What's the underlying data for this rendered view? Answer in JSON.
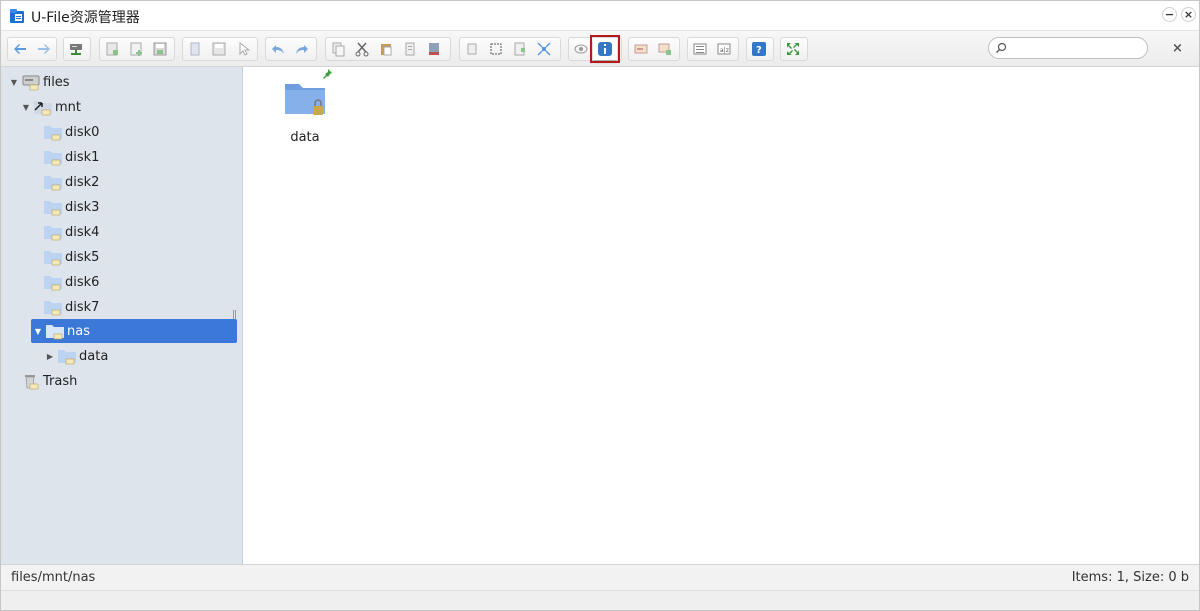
{
  "window": {
    "title": "U-File资源管理器"
  },
  "toolbar": {
    "groups": [
      {
        "buttons": [
          "back-icon",
          "forward-icon"
        ]
      },
      {
        "buttons": [
          "net-drive-icon"
        ]
      },
      {
        "buttons": [
          "new-folder-icon",
          "new-file-icon",
          "save-icon"
        ]
      },
      {
        "buttons": [
          "open-icon",
          "save-as-icon",
          "select-icon"
        ]
      },
      {
        "buttons": [
          "undo-icon",
          "redo-icon"
        ]
      },
      {
        "buttons": [
          "copy-icon",
          "cut-icon",
          "paste-icon",
          "duplicate-icon",
          "delete-icon"
        ]
      },
      {
        "buttons": [
          "select-all-icon",
          "deselect-icon",
          "invert-icon",
          "extract-icon"
        ]
      },
      {
        "buttons": [
          "preview-icon",
          "info-icon"
        ]
      },
      {
        "buttons": [
          "rename-icon",
          "edit-icon"
        ]
      },
      {
        "buttons": [
          "list-view-icon",
          "sort-icon"
        ]
      },
      {
        "buttons": [
          "help-icon"
        ]
      },
      {
        "buttons": [
          "fullscreen-icon"
        ]
      }
    ],
    "active_button": "info-icon",
    "search": {
      "value": "",
      "placeholder": ""
    },
    "clear_label": "×"
  },
  "sidebar": {
    "items": [
      {
        "label": "files",
        "icon": "drive-icon",
        "level": 0,
        "expanded": true
      },
      {
        "label": "mnt",
        "icon": "link-folder-icon",
        "level": 1,
        "expanded": true
      },
      {
        "label": "disk0",
        "icon": "folder-icon",
        "level": 2
      },
      {
        "label": "disk1",
        "icon": "folder-icon",
        "level": 2
      },
      {
        "label": "disk2",
        "icon": "folder-icon",
        "level": 2
      },
      {
        "label": "disk3",
        "icon": "folder-icon",
        "level": 2
      },
      {
        "label": "disk4",
        "icon": "folder-icon",
        "level": 2
      },
      {
        "label": "disk5",
        "icon": "folder-icon",
        "level": 2
      },
      {
        "label": "disk6",
        "icon": "folder-icon",
        "level": 2
      },
      {
        "label": "disk7",
        "icon": "folder-icon",
        "level": 2
      },
      {
        "label": "nas",
        "icon": "folder-icon",
        "level": 2,
        "expanded": true,
        "selected": true
      },
      {
        "label": "data",
        "icon": "folder-icon",
        "level": 3,
        "expanded": false
      },
      {
        "label": "Trash",
        "icon": "trash-icon",
        "level": 0
      }
    ]
  },
  "main": {
    "files": [
      {
        "name": "data",
        "icon": "folder-icon",
        "pinned": true,
        "locked": true
      }
    ]
  },
  "status": {
    "path": "files/mnt/nas",
    "info": "Items: 1, Size: 0 b"
  },
  "colors": {
    "selection": "#3b78d8",
    "sidebar": "#dde4ec",
    "active_outline": "#b31b1b",
    "folder": "#7fa9e6"
  }
}
